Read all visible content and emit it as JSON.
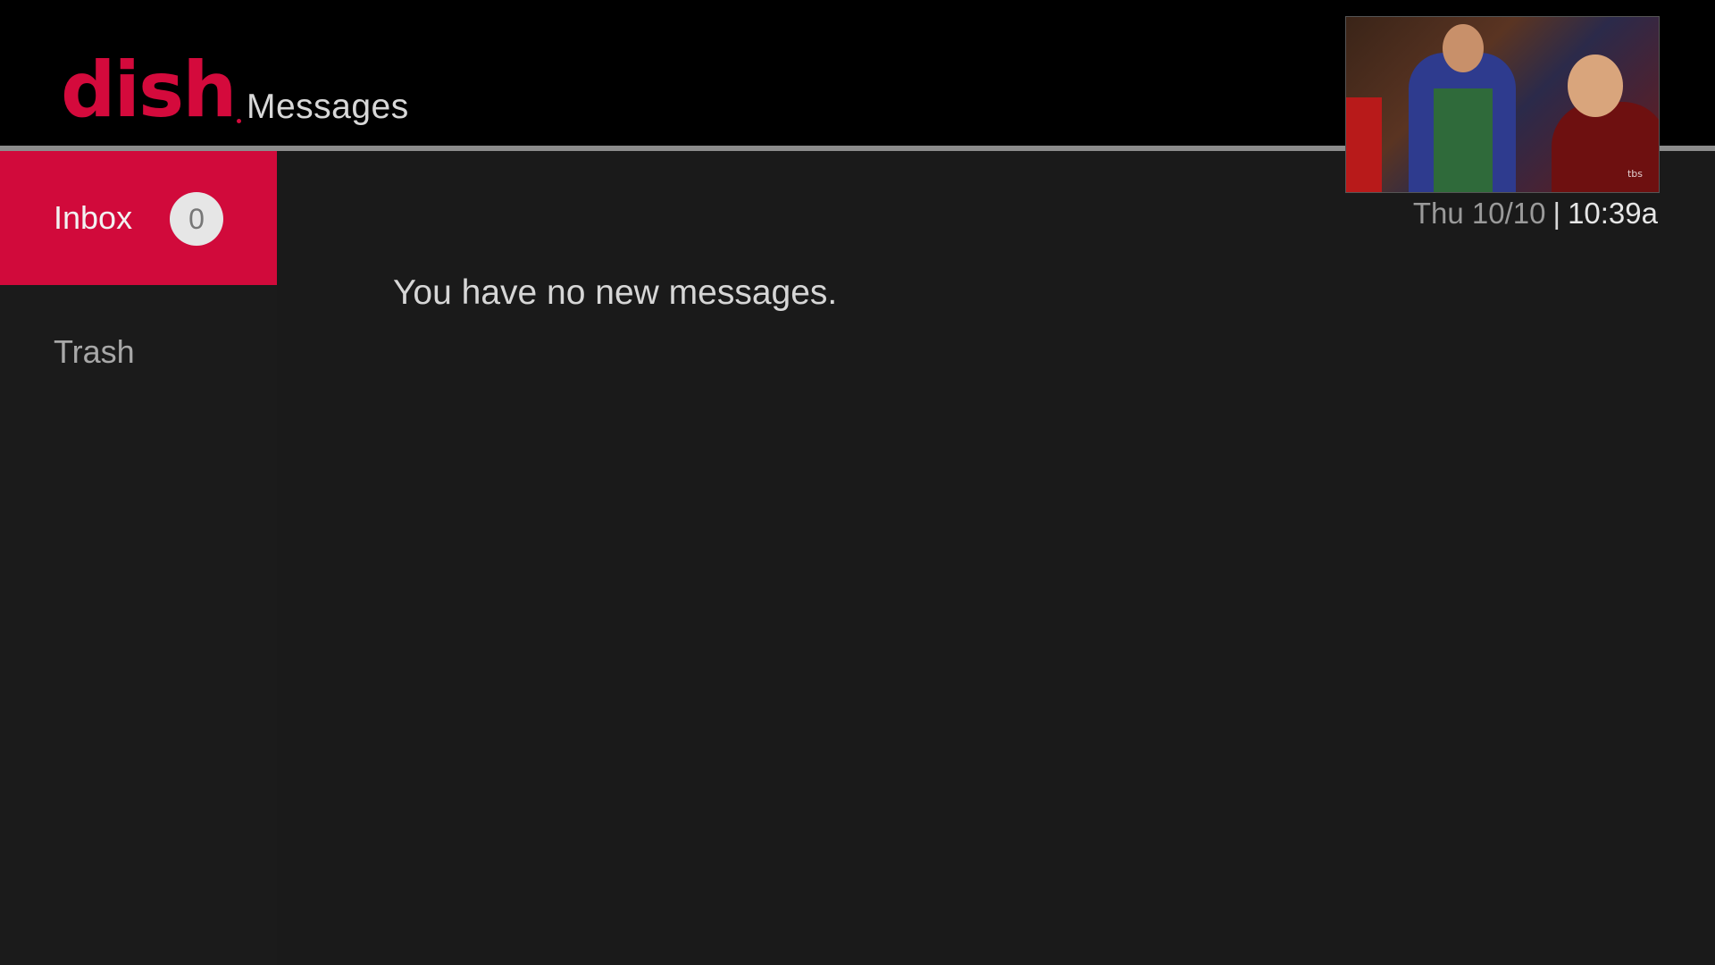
{
  "header": {
    "brand": "dish",
    "title": "Messages"
  },
  "preview": {
    "channel_bug": "tbs"
  },
  "clock": {
    "date": "Thu 10/10",
    "separator": "|",
    "time": "10:39a"
  },
  "sidebar": {
    "items": [
      {
        "label": "Inbox",
        "count": "0",
        "selected": true
      },
      {
        "label": "Trash",
        "selected": false
      }
    ]
  },
  "main": {
    "empty_message": "You have no new messages."
  },
  "colors": {
    "brand_red": "#d10a3b",
    "header_bg": "#000000",
    "body_bg": "#1a1a1a"
  }
}
